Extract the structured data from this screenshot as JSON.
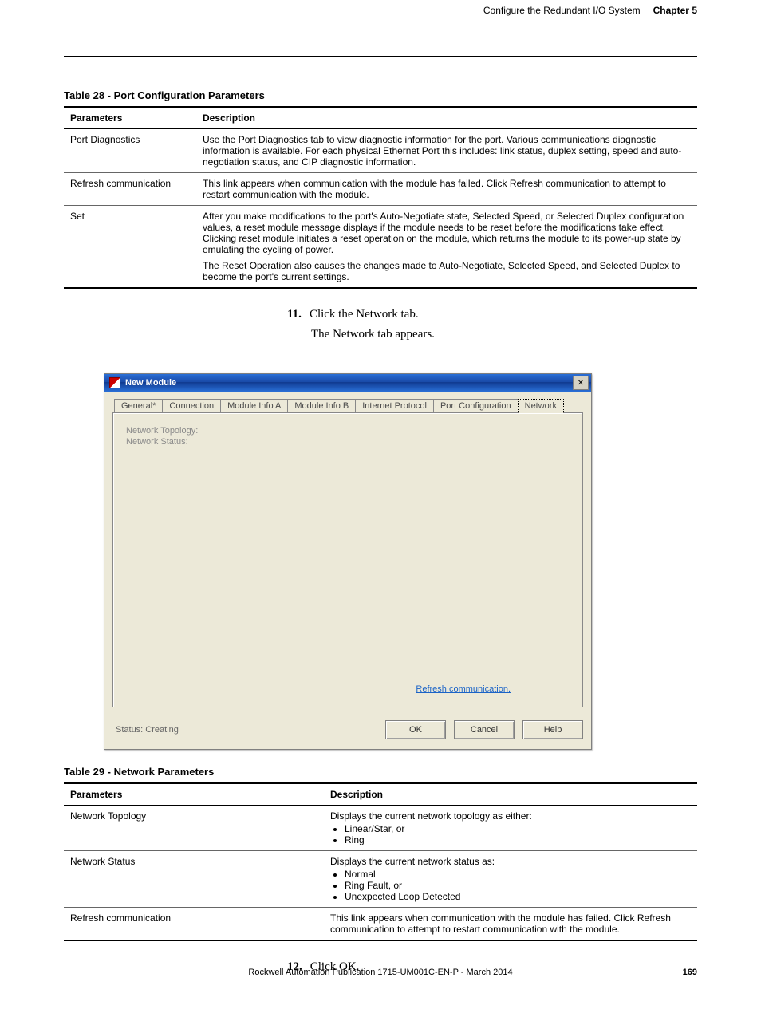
{
  "header": {
    "section": "Configure the Redundant I/O System",
    "chapter": "Chapter 5"
  },
  "table28": {
    "caption": "Table 28 - Port Configuration Parameters",
    "headers": {
      "param": "Parameters",
      "desc": "Description"
    },
    "rows": [
      {
        "param": "Port Diagnostics",
        "desc": "Use the Port Diagnostics tab to view diagnostic information for the port. Various communications diagnostic information is available. For each physical Ethernet Port this includes: link status, duplex setting, speed and auto-negotiation status, and CIP diagnostic information."
      },
      {
        "param": "Refresh communication",
        "desc": "This link appears when communication with the module has failed. Click Refresh communication to attempt to restart communication with the module."
      },
      {
        "param": "Set",
        "desc1": "After you make modifications to the port's Auto-Negotiate state, Selected Speed, or Selected Duplex configuration values, a reset module message displays if the module needs to be reset before the modifications take effect. Clicking reset module initiates a reset operation on the module, which returns the module to its power-up state by emulating the cycling of power.",
        "desc2": "The Reset Operation also causes the changes made to Auto-Negotiate, Selected Speed, and Selected Duplex to become the port's current settings."
      }
    ]
  },
  "step11": {
    "num": "11.",
    "text": "Click the Network tab."
  },
  "step11body": "The Network tab appears.",
  "dialog": {
    "title": "New Module",
    "tabs": [
      "General*",
      "Connection",
      "Module Info A",
      "Module Info B",
      "Internet Protocol",
      "Port Configuration",
      "Network"
    ],
    "fields": {
      "topology_label": "Network Topology:",
      "status_label": "Network Status:"
    },
    "refresh": "Refresh communication.",
    "status": "Status: Creating",
    "buttons": {
      "ok": "OK",
      "cancel": "Cancel",
      "help": "Help"
    }
  },
  "table29": {
    "caption": "Table 29 - Network Parameters",
    "headers": {
      "param": "Parameters",
      "desc": "Description"
    },
    "rows": [
      {
        "param": "Network Topology",
        "desc_pre": "Displays the current network topology as either:",
        "bullets": [
          "Linear/Star, or",
          "Ring"
        ]
      },
      {
        "param": "Network Status",
        "desc_pre": "Displays the current network status as:",
        "bullets": [
          "Normal",
          "Ring Fault, or",
          "Unexpected Loop Detected"
        ]
      },
      {
        "param": "Refresh communication",
        "desc": "This link appears when communication with the module has failed. Click Refresh communication to attempt to restart communication with the module."
      }
    ]
  },
  "step12": {
    "num": "12.",
    "text": "Click OK."
  },
  "footer": {
    "pub": "Rockwell Automation Publication 1715-UM001C-EN-P - March 2014",
    "page": "169"
  }
}
